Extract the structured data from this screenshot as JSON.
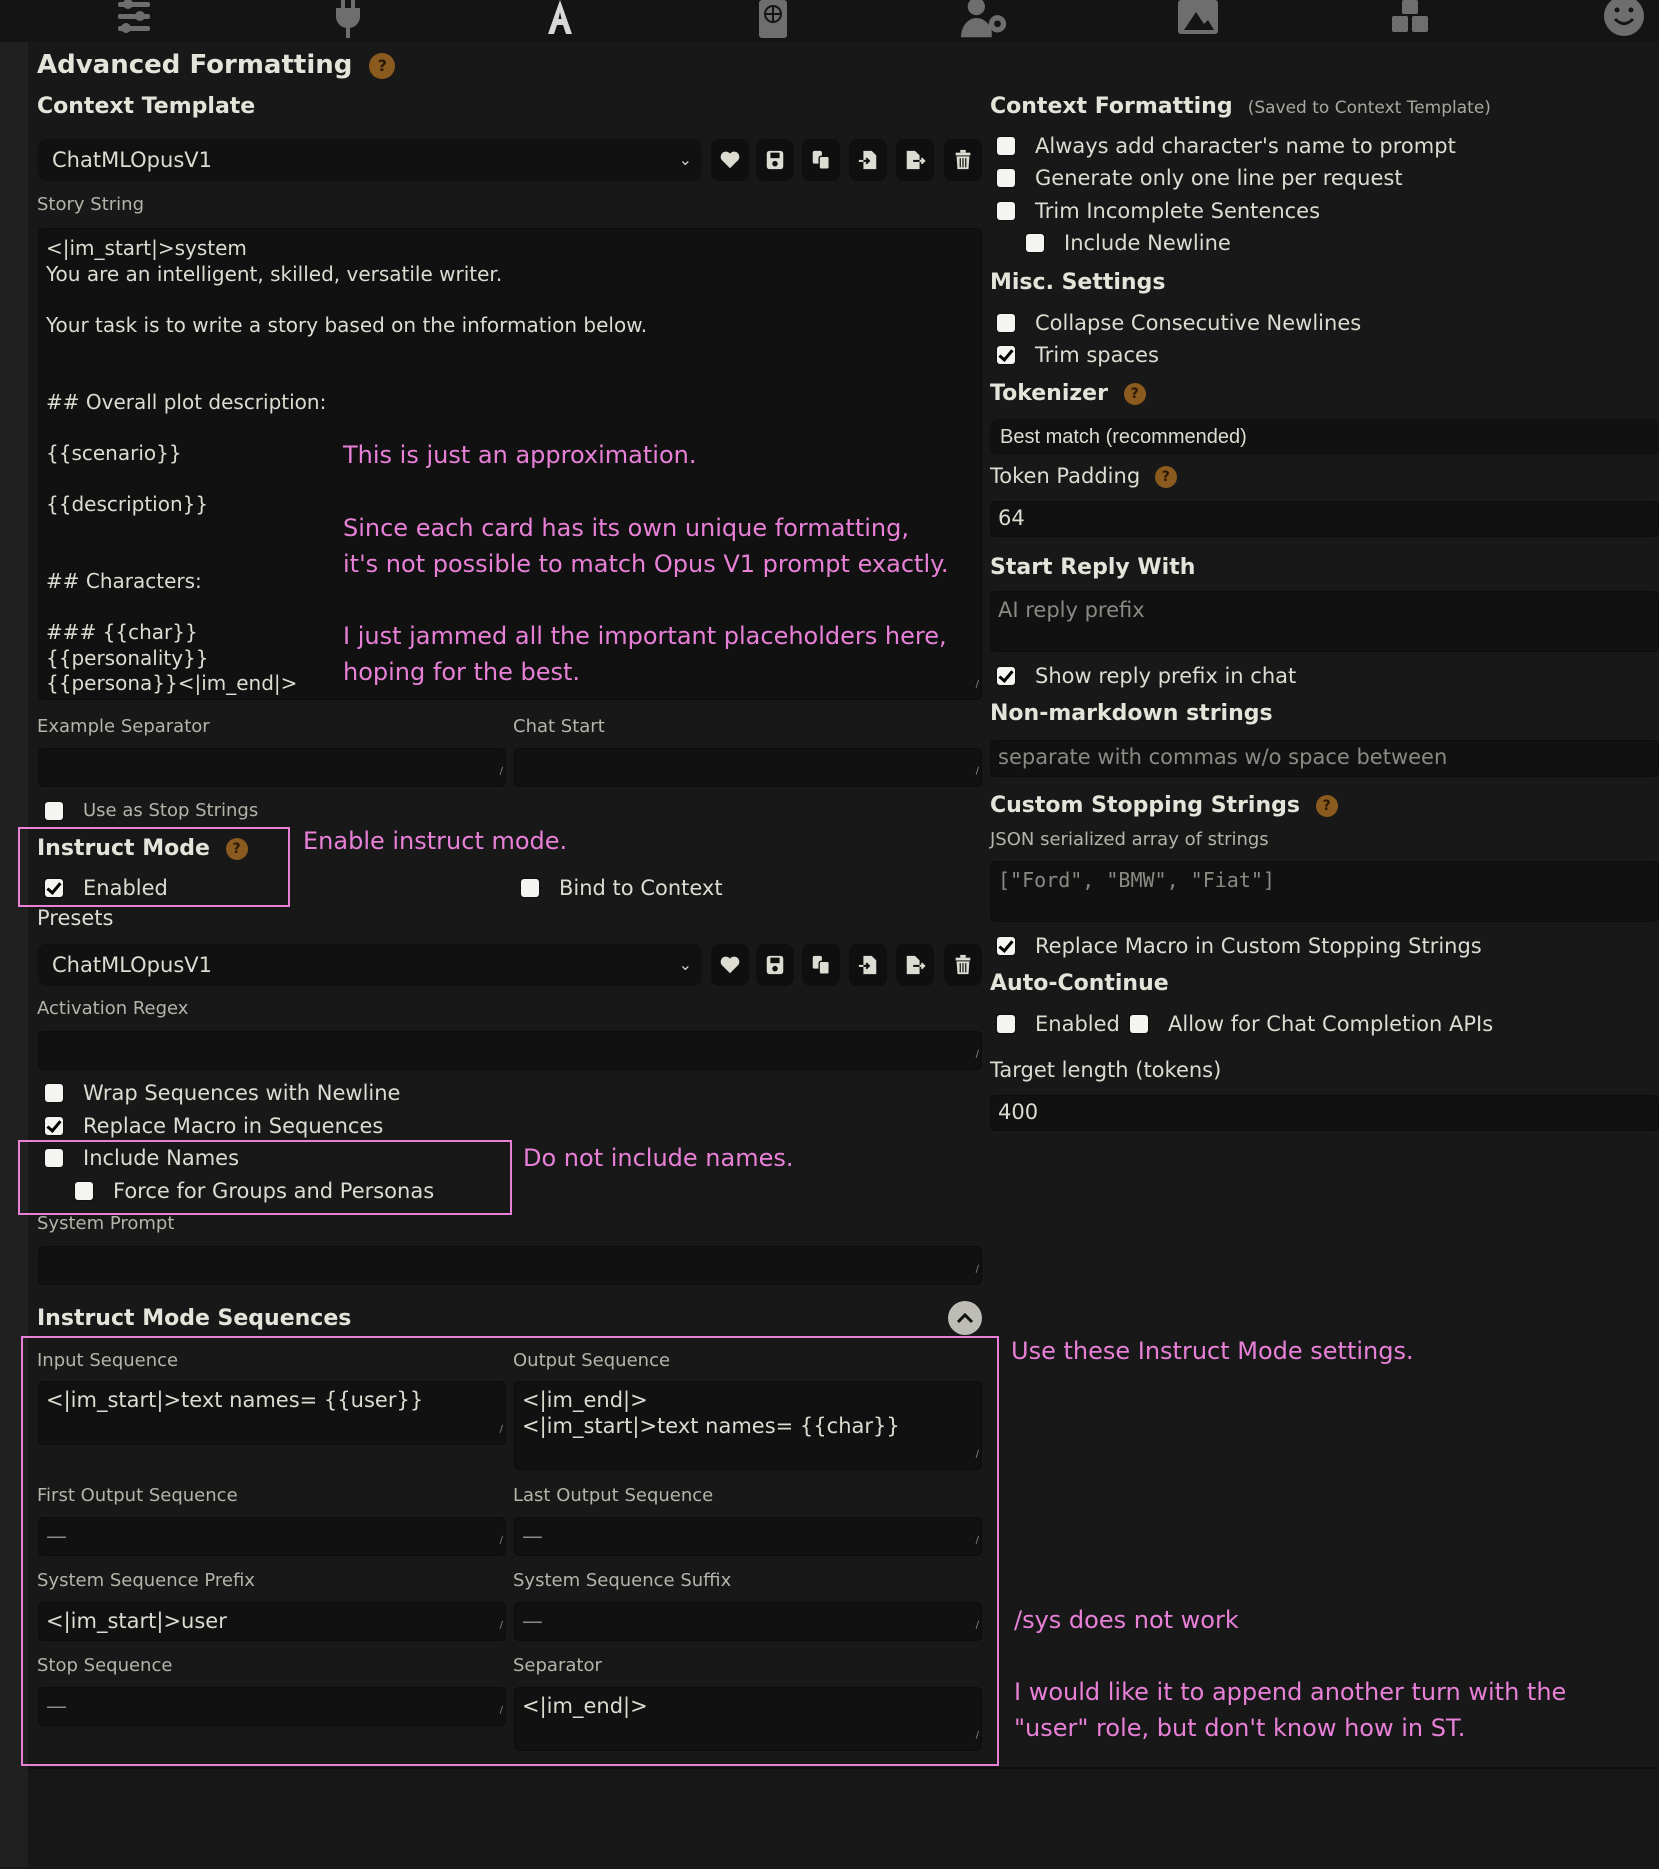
{
  "topnav": {
    "icons": [
      {
        "name": "sliders-icon",
        "active": false
      },
      {
        "name": "plug-icon",
        "active": false
      },
      {
        "name": "font-icon",
        "active": true
      },
      {
        "name": "book-globe-icon",
        "active": false
      },
      {
        "name": "user-gear-icon",
        "active": false
      },
      {
        "name": "image-icon",
        "active": false
      },
      {
        "name": "cubes-icon",
        "active": false
      },
      {
        "name": "smiley-icon",
        "active": false
      }
    ]
  },
  "page": {
    "title": "Advanced Formatting",
    "help": "?"
  },
  "context_template": {
    "heading": "Context Template",
    "selected": "ChatMLOpusV1",
    "story_string_label": "Story String",
    "story_string": "<|im_start|>system\nYou are an intelligent, skilled, versatile writer.\n\nYour task is to write a story based on the information below.\n\n\n## Overall plot description:\n\n{{scenario}}\n\n{{description}}\n\n\n## Characters:\n\n### {{char}}\n{{personality}}\n{{persona}}<|im_end|>",
    "example_separator_label": "Example Separator",
    "example_separator_value": "",
    "chat_start_label": "Chat Start",
    "chat_start_value": "",
    "use_as_stop_strings": {
      "label": "Use as Stop Strings",
      "checked": false
    }
  },
  "instruct_mode": {
    "heading": "Instruct Mode",
    "enabled": {
      "label": "Enabled",
      "checked": true
    },
    "bind_to_context": {
      "label": "Bind to Context",
      "checked": false
    },
    "presets_label": "Presets",
    "preset_selected": "ChatMLOpusV1",
    "activation_regex_label": "Activation Regex",
    "activation_regex_value": "",
    "wrap_sequences": {
      "label": "Wrap Sequences with Newline",
      "checked": false
    },
    "replace_macro": {
      "label": "Replace Macro in Sequences",
      "checked": true
    },
    "include_names": {
      "label": "Include Names",
      "checked": false
    },
    "force_groups": {
      "label": "Force for Groups and Personas",
      "checked": false
    },
    "system_prompt_label": "System Prompt",
    "system_prompt_value": ""
  },
  "sequences": {
    "heading": "Instruct Mode Sequences",
    "input_label": "Input Sequence",
    "input_value": "<|im_start|>text names= {{user}}",
    "output_label": "Output Sequence",
    "output_value": "<|im_end|>\n<|im_start|>text names= {{char}}",
    "first_output_label": "First Output Sequence",
    "first_output_placeholder": "—",
    "last_output_label": "Last Output Sequence",
    "last_output_placeholder": "—",
    "sys_prefix_label": "System Sequence Prefix",
    "sys_prefix_value": "<|im_start|>user",
    "sys_suffix_label": "System Sequence Suffix",
    "sys_suffix_placeholder": "—",
    "stop_label": "Stop Sequence",
    "stop_placeholder": "—",
    "separator_label": "Separator",
    "separator_value": "<|im_end|>"
  },
  "context_formatting": {
    "heading": "Context Formatting",
    "note": "(Saved to Context Template)",
    "always_add_name": {
      "label": "Always add character's name to prompt",
      "checked": false
    },
    "one_line": {
      "label": "Generate only one line per request",
      "checked": false
    },
    "trim_incomplete": {
      "label": "Trim Incomplete Sentences",
      "checked": false
    },
    "include_newline": {
      "label": "Include Newline",
      "checked": false
    }
  },
  "misc": {
    "heading": "Misc. Settings",
    "collapse_newlines": {
      "label": "Collapse Consecutive Newlines",
      "checked": false
    },
    "trim_spaces": {
      "label": "Trim spaces",
      "checked": true
    }
  },
  "tokenizer": {
    "heading": "Tokenizer",
    "selected": "Best match (recommended)",
    "token_padding_label": "Token Padding",
    "token_padding_value": "64"
  },
  "start_reply": {
    "heading": "Start Reply With",
    "placeholder": "AI reply prefix",
    "show_prefix": {
      "label": "Show reply prefix in chat",
      "checked": true
    }
  },
  "non_markdown": {
    "heading": "Non-markdown strings",
    "placeholder": "separate with commas w/o space between"
  },
  "stopping": {
    "heading": "Custom Stopping Strings",
    "subtitle": "JSON serialized array of strings",
    "placeholder": "[\"Ford\", \"BMW\", \"Fiat\"]",
    "replace_macro": {
      "label": "Replace Macro in Custom Stopping Strings",
      "checked": true
    }
  },
  "auto_continue": {
    "heading": "Auto-Continue",
    "enabled": {
      "label": "Enabled",
      "checked": false
    },
    "allow_chat": {
      "label": "Allow for Chat Completion APIs",
      "checked": false
    },
    "target_label": "Target length (tokens)",
    "target_value": "400"
  },
  "annotations": {
    "approx": "This is just an approximation.",
    "unique_1": "Since each card has its own unique formatting,",
    "unique_2": "it's not possible to match Opus V1 prompt exactly.",
    "jammed_1": "I just jammed all the important placeholders here,",
    "jammed_2": "hoping for the best.",
    "enable_instruct": "Enable instruct mode.",
    "no_names": "Do not include names.",
    "use_settings": "Use these Instruct Mode settings.",
    "sys_not_work": "/sys does not work",
    "append_1": "I would like it to append another turn with the",
    "append_2": "\"user\" role, but don't know how in ST.",
    "color": "#e880d8"
  }
}
